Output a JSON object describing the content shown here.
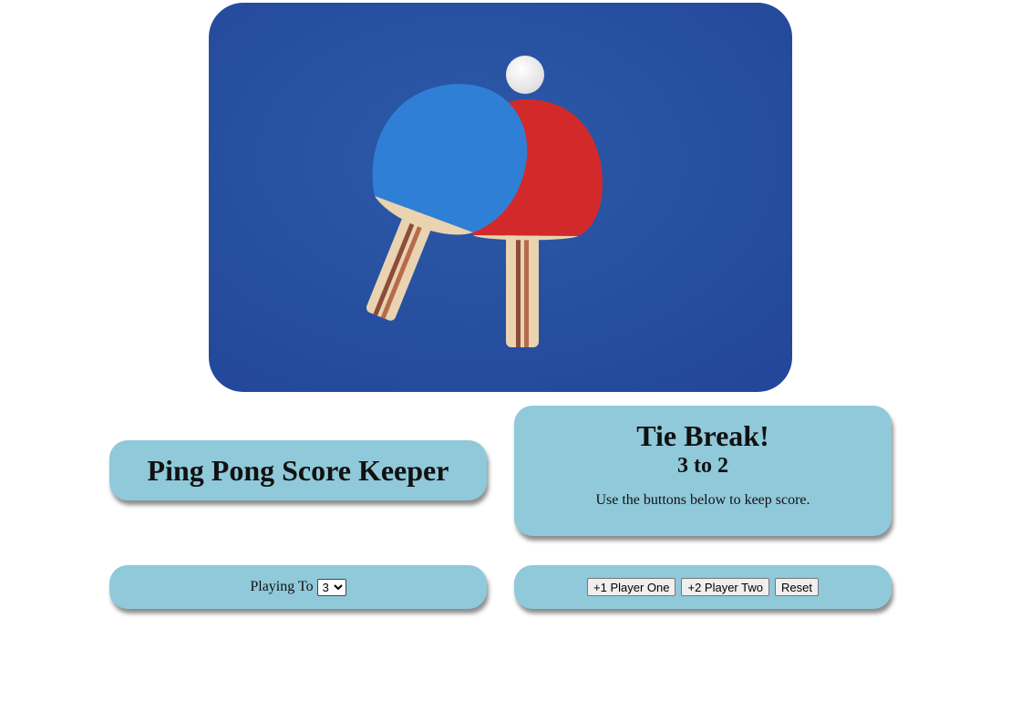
{
  "hero": {
    "image_description_icon": "ping-pong-paddles-and-ball"
  },
  "title": {
    "text": "Ping Pong Score Keeper"
  },
  "score_panel": {
    "status": "Tie Break!",
    "score_text": "3 to 2",
    "hint": "Use the buttons below to keep score."
  },
  "playing_to": {
    "label": "Playing To",
    "selected": "3"
  },
  "controls": {
    "player_one_label": "+1 Player One",
    "player_two_label": "+2 Player Two",
    "reset_label": "Reset"
  },
  "colors": {
    "card_background": "#90c9d9",
    "table_blue": "#2a55a0",
    "paddle_blue": "#2f7fd6",
    "paddle_red": "#d22a2a"
  }
}
